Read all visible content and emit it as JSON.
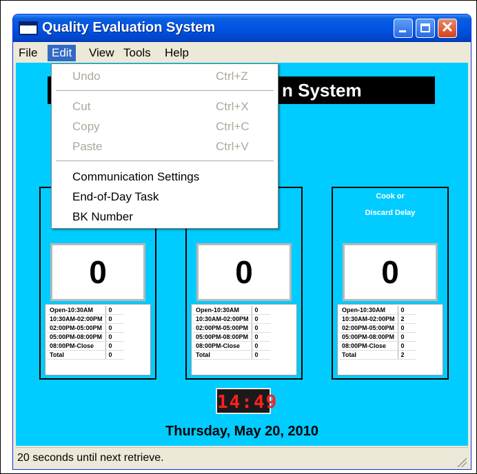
{
  "window": {
    "title": "Quality Evaluation System",
    "buttons": [
      "minimize",
      "maximize",
      "close"
    ]
  },
  "menubar": {
    "items": [
      {
        "label": "File"
      },
      {
        "label": "Edit",
        "active": true
      },
      {
        "label": "View"
      },
      {
        "label": "Tools"
      },
      {
        "label": "Help"
      }
    ]
  },
  "edit_menu": {
    "undo": {
      "label": "Undo",
      "shortcut": "Ctrl+Z",
      "enabled": false
    },
    "cut": {
      "label": "Cut",
      "shortcut": "Ctrl+X",
      "enabled": false
    },
    "copy": {
      "label": "Copy",
      "shortcut": "Ctrl+C",
      "enabled": false
    },
    "paste": {
      "label": "Paste",
      "shortcut": "Ctrl+V",
      "enabled": false
    },
    "communication_settings": {
      "label": "Communication Settings"
    },
    "end_of_day": {
      "label": "End-of-Day Task"
    },
    "bk_number": {
      "label": "BK Number"
    }
  },
  "banner": {
    "visible_text": "n System"
  },
  "panels": [
    {
      "title_line1": "",
      "title_line2": "",
      "count": "0",
      "rows": [
        {
          "label": "Open-10:30AM",
          "value": "0"
        },
        {
          "label": "10:30AM-02:00PM",
          "value": "0"
        },
        {
          "label": "02:00PM-05:00PM",
          "value": "0"
        },
        {
          "label": "05:00PM-08:00PM",
          "value": "0"
        },
        {
          "label": "08:00PM-Close",
          "value": "0"
        },
        {
          "label": "Total",
          "value": "0"
        }
      ]
    },
    {
      "title_line1": "",
      "title_line2": "",
      "count": "0",
      "rows": [
        {
          "label": "Open-10:30AM",
          "value": "0"
        },
        {
          "label": "10:30AM-02:00PM",
          "value": "0"
        },
        {
          "label": "02:00PM-05:00PM",
          "value": "0"
        },
        {
          "label": "05:00PM-08:00PM",
          "value": "0"
        },
        {
          "label": "08:00PM-Close",
          "value": "0"
        },
        {
          "label": "Total",
          "value": "0"
        }
      ]
    },
    {
      "title_line1": "Cook or",
      "title_line2": "Discard Delay",
      "count": "0",
      "rows": [
        {
          "label": "Open-10:30AM",
          "value": "0"
        },
        {
          "label": "10:30AM-02:00PM",
          "value": "2"
        },
        {
          "label": "02:00PM-05:00PM",
          "value": "0"
        },
        {
          "label": "05:00PM-08:00PM",
          "value": "0"
        },
        {
          "label": "08:00PM-Close",
          "value": "0"
        },
        {
          "label": "Total",
          "value": "2"
        }
      ]
    }
  ],
  "clock": {
    "time": "14:49",
    "color": "#ff2020"
  },
  "date": "Thursday, May 20, 2010",
  "status": "20 seconds until next retrieve.",
  "colors": {
    "client_background": "#00ccff",
    "titlebar": "#0054e3",
    "menu_highlight": "#316ac5"
  }
}
